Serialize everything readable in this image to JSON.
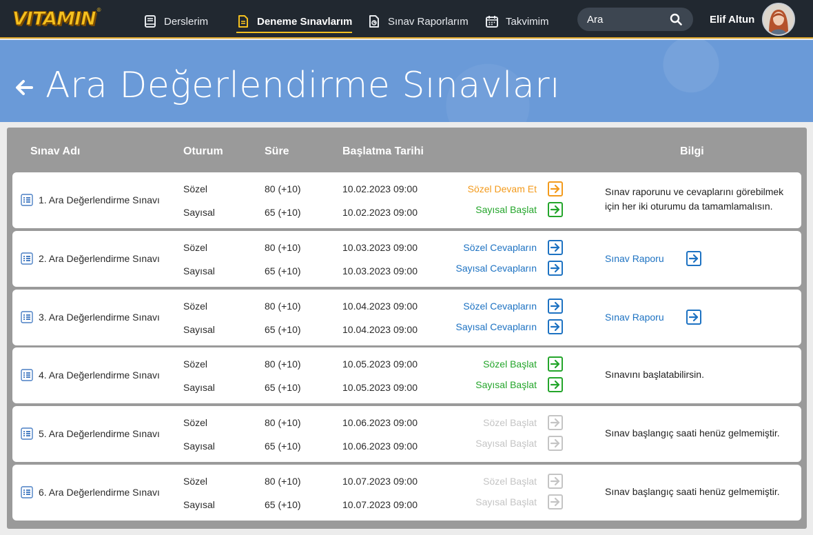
{
  "brand": {
    "logo_text": "VITAMIN",
    "logo_mark": "®"
  },
  "nav": [
    {
      "label": "Derslerim",
      "icon": "book-icon",
      "active": false
    },
    {
      "label": "Deneme Sınavlarım",
      "icon": "document-icon",
      "active": true
    },
    {
      "label": "Sınav Raporlarım",
      "icon": "report-icon",
      "active": false
    },
    {
      "label": "Takvimim",
      "icon": "calendar-icon",
      "active": false
    }
  ],
  "search": {
    "placeholder": "Ara"
  },
  "user": {
    "name": "Elif Altun"
  },
  "page": {
    "title": "Ara Değerlendirme Sınavları"
  },
  "table": {
    "headers": {
      "name": "Sınav Adı",
      "session": "Oturum",
      "duration": "Süre",
      "start": "Başlatma Tarihi",
      "info": "Bilgi"
    },
    "rows": [
      {
        "name": "1. Ara Değerlendirme Sınavı",
        "s1": "Sözel",
        "d1": "80 (+10)",
        "t1": "10.02.2023 09:00",
        "a1": "Sözel Devam Et",
        "a1_state": "orange",
        "s2": "Sayısal",
        "d2": "65 (+10)",
        "t2": "10.02.2023 09:00",
        "a2": "Sayısal Başlat",
        "a2_state": "green",
        "info_type": "text",
        "info": "Sınav raporunu ve cevaplarını görebilmek için her iki oturumu da tamamlamalısın."
      },
      {
        "name": "2. Ara Değerlendirme Sınavı",
        "s1": "Sözel",
        "d1": "80 (+10)",
        "t1": "10.03.2023 09:00",
        "a1": "Sözel Cevapların",
        "a1_state": "blue",
        "s2": "Sayısal",
        "d2": "65 (+10)",
        "t2": "10.03.2023 09:00",
        "a2": "Sayısal Cevapların",
        "a2_state": "blue",
        "info_type": "link",
        "info": "Sınav Raporu"
      },
      {
        "name": "3. Ara Değerlendirme Sınavı",
        "s1": "Sözel",
        "d1": "80 (+10)",
        "t1": "10.04.2023 09:00",
        "a1": "Sözel Cevapların",
        "a1_state": "blue",
        "s2": "Sayısal",
        "d2": "65 (+10)",
        "t2": "10.04.2023 09:00",
        "a2": "Sayısal Cevapların",
        "a2_state": "blue",
        "info_type": "link",
        "info": "Sınav Raporu"
      },
      {
        "name": "4. Ara Değerlendirme Sınavı",
        "s1": "Sözel",
        "d1": "80 (+10)",
        "t1": "10.05.2023 09:00",
        "a1": "Sözel Başlat",
        "a1_state": "green",
        "s2": "Sayısal",
        "d2": "65 (+10)",
        "t2": "10.05.2023 09:00",
        "a2": "Sayısal Başlat",
        "a2_state": "green",
        "info_type": "text",
        "info": "Sınavını başlatabilirsin."
      },
      {
        "name": "5. Ara Değerlendirme Sınavı",
        "s1": "Sözel",
        "d1": "80 (+10)",
        "t1": "10.06.2023 09:00",
        "a1": "Sözel Başlat",
        "a1_state": "disabled",
        "s2": "Sayısal",
        "d2": "65 (+10)",
        "t2": "10.06.2023 09:00",
        "a2": "Sayısal Başlat",
        "a2_state": "disabled",
        "info_type": "text",
        "info": "Sınav başlangıç saati henüz gelmemiştir."
      },
      {
        "name": "6. Ara Değerlendirme Sınavı",
        "s1": "Sözel",
        "d1": "80 (+10)",
        "t1": "10.07.2023 09:00",
        "a1": "Sözel Başlat",
        "a1_state": "disabled",
        "s2": "Sayısal",
        "d2": "65 (+10)",
        "t2": "10.07.2023 09:00",
        "a2": "Sayısal Başlat",
        "a2_state": "disabled",
        "info_type": "text",
        "info": "Sınav başlangıç saati henüz gelmemiştir."
      }
    ]
  },
  "colors": {
    "topbar": "#212830",
    "accent_yellow": "#f5c11f",
    "banner": "#6a9ad8",
    "panel": "#9a9a9a",
    "orange": "#f39a1b",
    "green": "#23a52a",
    "blue": "#1d72c2",
    "disabled": "#c4c4c4"
  }
}
